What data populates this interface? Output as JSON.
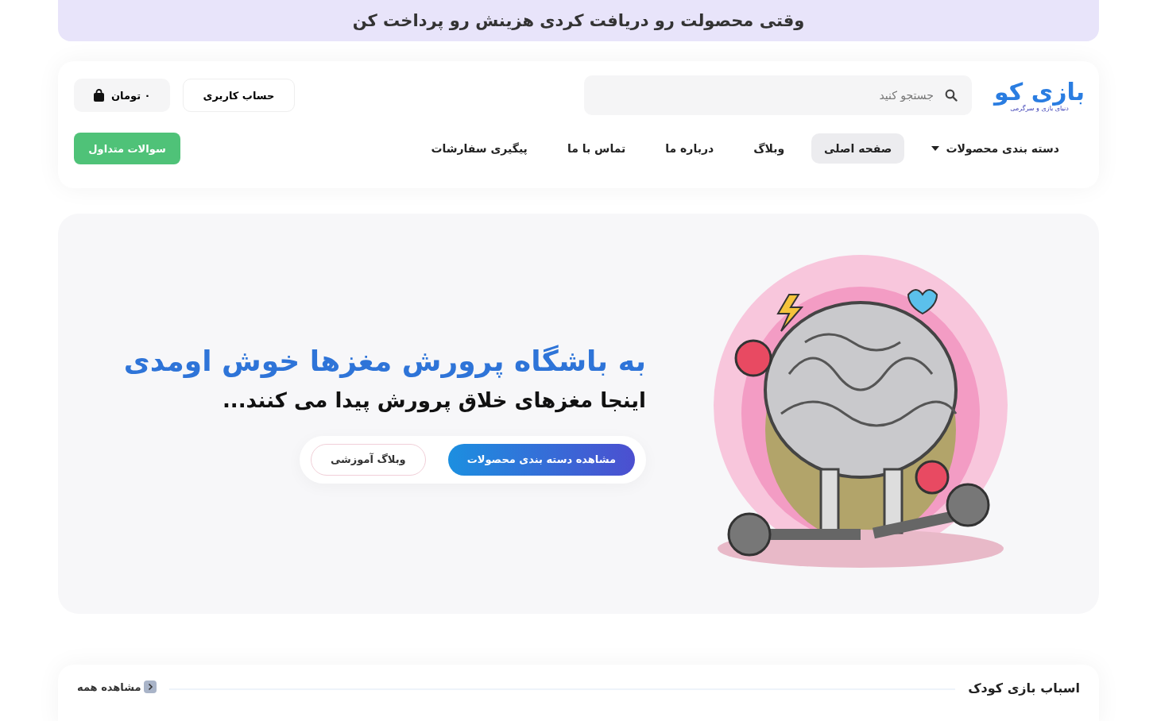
{
  "announcement": "وقتی محصولت رو دریافت کردی هزینش رو پرداخت کن",
  "header": {
    "logo": {
      "name": "بازی کو",
      "tagline": "دنیای بازی و سرگرمی"
    },
    "search": {
      "placeholder": "جستجو کنید"
    },
    "account_button": "حساب کاربری",
    "cart_button": "۰ تومان",
    "nav": [
      {
        "label": "دسته بندی محصولات",
        "kind": "dropdown",
        "selected": false
      },
      {
        "label": "صفحه اصلی",
        "kind": "link",
        "selected": true
      },
      {
        "label": "وبلاگ",
        "kind": "link",
        "selected": false
      },
      {
        "label": "درباره ما",
        "kind": "link",
        "selected": false
      },
      {
        "label": "تماس با ما",
        "kind": "link",
        "selected": false
      },
      {
        "label": "پیگیری سفارشات",
        "kind": "link",
        "selected": false
      }
    ],
    "faq_button": "سوالات متداول"
  },
  "hero": {
    "title": "به باشگاه پرورش مغزها خوش اومدی",
    "subtitle": "اینجا مغزهای خلاق پرورش پیدا می کنند...",
    "buttons": [
      {
        "label": "مشاهده دسته بندی محصولات",
        "kind": "primary"
      },
      {
        "label": "وبلاگ آموزشی",
        "kind": "secondary"
      }
    ]
  },
  "section": {
    "title": "اسباب بازی کودک",
    "view_all": "مشاهده همه"
  }
}
